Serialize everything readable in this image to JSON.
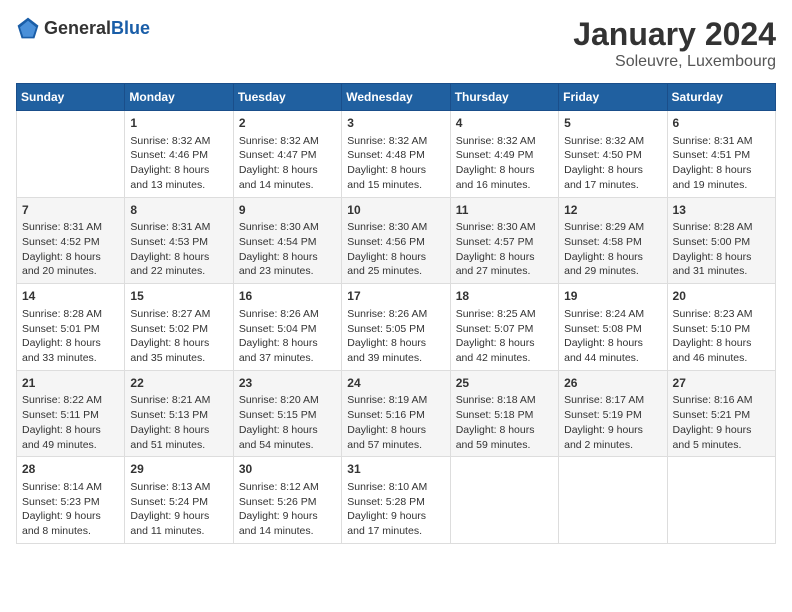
{
  "header": {
    "logo_general": "General",
    "logo_blue": "Blue",
    "month": "January 2024",
    "location": "Soleuvre, Luxembourg"
  },
  "days_of_week": [
    "Sunday",
    "Monday",
    "Tuesday",
    "Wednesday",
    "Thursday",
    "Friday",
    "Saturday"
  ],
  "weeks": [
    [
      {
        "day": "",
        "info": ""
      },
      {
        "day": "1",
        "info": "Sunrise: 8:32 AM\nSunset: 4:46 PM\nDaylight: 8 hours\nand 13 minutes."
      },
      {
        "day": "2",
        "info": "Sunrise: 8:32 AM\nSunset: 4:47 PM\nDaylight: 8 hours\nand 14 minutes."
      },
      {
        "day": "3",
        "info": "Sunrise: 8:32 AM\nSunset: 4:48 PM\nDaylight: 8 hours\nand 15 minutes."
      },
      {
        "day": "4",
        "info": "Sunrise: 8:32 AM\nSunset: 4:49 PM\nDaylight: 8 hours\nand 16 minutes."
      },
      {
        "day": "5",
        "info": "Sunrise: 8:32 AM\nSunset: 4:50 PM\nDaylight: 8 hours\nand 17 minutes."
      },
      {
        "day": "6",
        "info": "Sunrise: 8:31 AM\nSunset: 4:51 PM\nDaylight: 8 hours\nand 19 minutes."
      }
    ],
    [
      {
        "day": "7",
        "info": "Sunrise: 8:31 AM\nSunset: 4:52 PM\nDaylight: 8 hours\nand 20 minutes."
      },
      {
        "day": "8",
        "info": "Sunrise: 8:31 AM\nSunset: 4:53 PM\nDaylight: 8 hours\nand 22 minutes."
      },
      {
        "day": "9",
        "info": "Sunrise: 8:30 AM\nSunset: 4:54 PM\nDaylight: 8 hours\nand 23 minutes."
      },
      {
        "day": "10",
        "info": "Sunrise: 8:30 AM\nSunset: 4:56 PM\nDaylight: 8 hours\nand 25 minutes."
      },
      {
        "day": "11",
        "info": "Sunrise: 8:30 AM\nSunset: 4:57 PM\nDaylight: 8 hours\nand 27 minutes."
      },
      {
        "day": "12",
        "info": "Sunrise: 8:29 AM\nSunset: 4:58 PM\nDaylight: 8 hours\nand 29 minutes."
      },
      {
        "day": "13",
        "info": "Sunrise: 8:28 AM\nSunset: 5:00 PM\nDaylight: 8 hours\nand 31 minutes."
      }
    ],
    [
      {
        "day": "14",
        "info": "Sunrise: 8:28 AM\nSunset: 5:01 PM\nDaylight: 8 hours\nand 33 minutes."
      },
      {
        "day": "15",
        "info": "Sunrise: 8:27 AM\nSunset: 5:02 PM\nDaylight: 8 hours\nand 35 minutes."
      },
      {
        "day": "16",
        "info": "Sunrise: 8:26 AM\nSunset: 5:04 PM\nDaylight: 8 hours\nand 37 minutes."
      },
      {
        "day": "17",
        "info": "Sunrise: 8:26 AM\nSunset: 5:05 PM\nDaylight: 8 hours\nand 39 minutes."
      },
      {
        "day": "18",
        "info": "Sunrise: 8:25 AM\nSunset: 5:07 PM\nDaylight: 8 hours\nand 42 minutes."
      },
      {
        "day": "19",
        "info": "Sunrise: 8:24 AM\nSunset: 5:08 PM\nDaylight: 8 hours\nand 44 minutes."
      },
      {
        "day": "20",
        "info": "Sunrise: 8:23 AM\nSunset: 5:10 PM\nDaylight: 8 hours\nand 46 minutes."
      }
    ],
    [
      {
        "day": "21",
        "info": "Sunrise: 8:22 AM\nSunset: 5:11 PM\nDaylight: 8 hours\nand 49 minutes."
      },
      {
        "day": "22",
        "info": "Sunrise: 8:21 AM\nSunset: 5:13 PM\nDaylight: 8 hours\nand 51 minutes."
      },
      {
        "day": "23",
        "info": "Sunrise: 8:20 AM\nSunset: 5:15 PM\nDaylight: 8 hours\nand 54 minutes."
      },
      {
        "day": "24",
        "info": "Sunrise: 8:19 AM\nSunset: 5:16 PM\nDaylight: 8 hours\nand 57 minutes."
      },
      {
        "day": "25",
        "info": "Sunrise: 8:18 AM\nSunset: 5:18 PM\nDaylight: 8 hours\nand 59 minutes."
      },
      {
        "day": "26",
        "info": "Sunrise: 8:17 AM\nSunset: 5:19 PM\nDaylight: 9 hours\nand 2 minutes."
      },
      {
        "day": "27",
        "info": "Sunrise: 8:16 AM\nSunset: 5:21 PM\nDaylight: 9 hours\nand 5 minutes."
      }
    ],
    [
      {
        "day": "28",
        "info": "Sunrise: 8:14 AM\nSunset: 5:23 PM\nDaylight: 9 hours\nand 8 minutes."
      },
      {
        "day": "29",
        "info": "Sunrise: 8:13 AM\nSunset: 5:24 PM\nDaylight: 9 hours\nand 11 minutes."
      },
      {
        "day": "30",
        "info": "Sunrise: 8:12 AM\nSunset: 5:26 PM\nDaylight: 9 hours\nand 14 minutes."
      },
      {
        "day": "31",
        "info": "Sunrise: 8:10 AM\nSunset: 5:28 PM\nDaylight: 9 hours\nand 17 minutes."
      },
      {
        "day": "",
        "info": ""
      },
      {
        "day": "",
        "info": ""
      },
      {
        "day": "",
        "info": ""
      }
    ]
  ]
}
